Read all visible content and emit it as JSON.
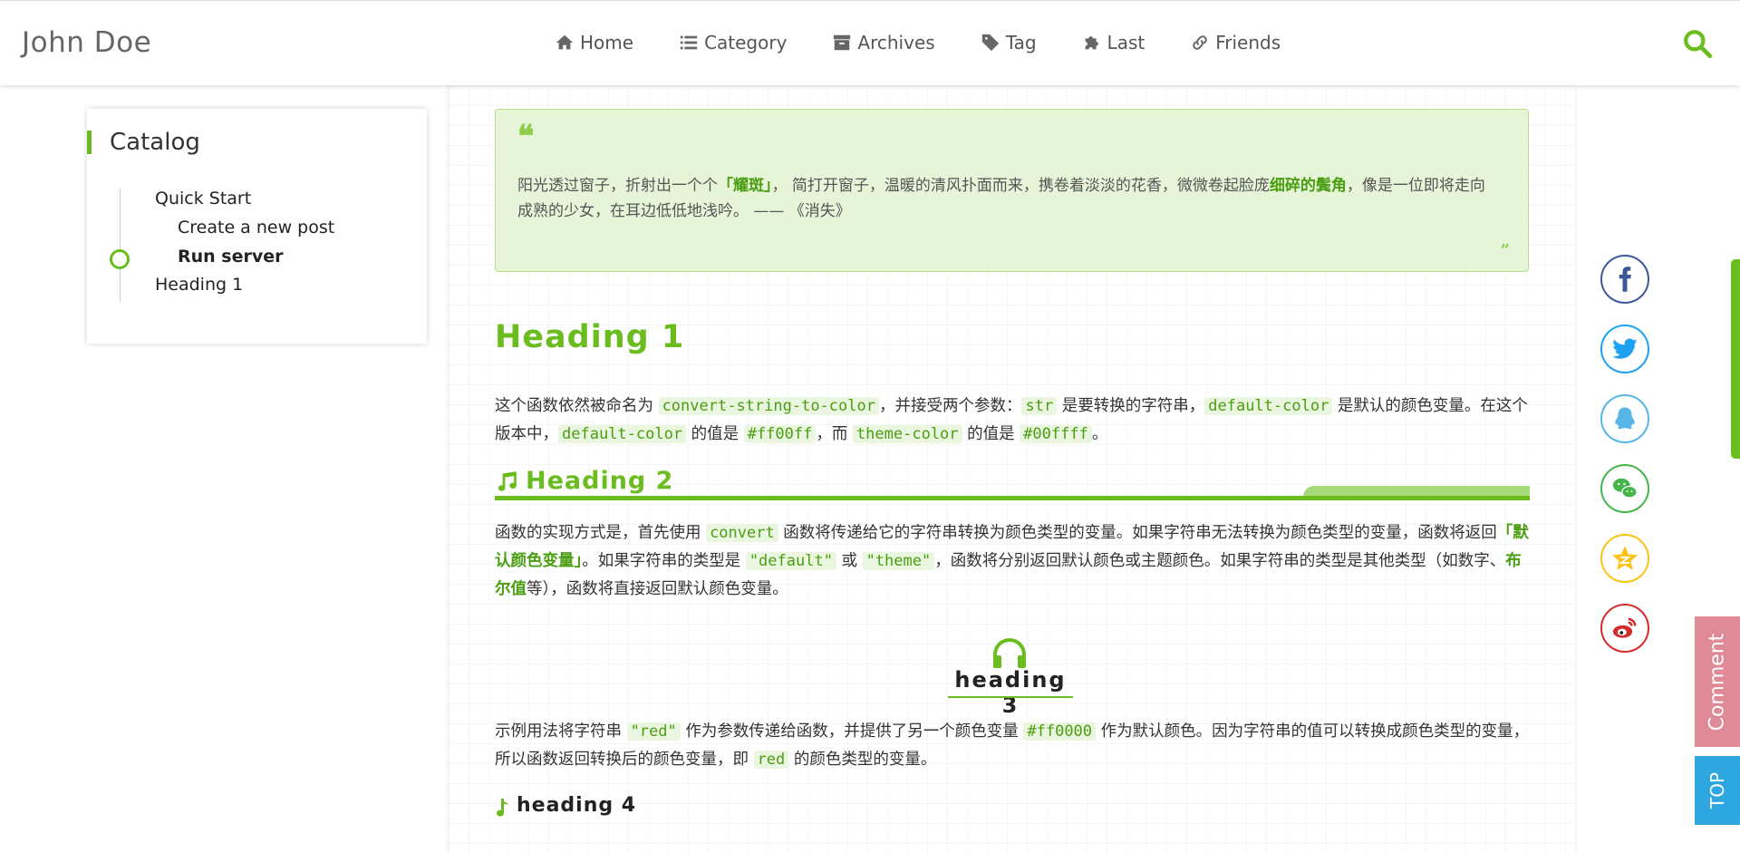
{
  "header": {
    "brand": "John Doe",
    "nav": [
      {
        "label": "Home",
        "icon": "home-icon"
      },
      {
        "label": "Category",
        "icon": "list-icon"
      },
      {
        "label": "Archives",
        "icon": "archive-icon"
      },
      {
        "label": "Tag",
        "icon": "tag-icon"
      },
      {
        "label": "Last",
        "icon": "puzzle-icon"
      },
      {
        "label": "Friends",
        "icon": "link-icon"
      }
    ],
    "search_icon": "search-icon"
  },
  "catalog": {
    "title": "Catalog",
    "items": [
      {
        "label": "Quick Start",
        "level": 1,
        "active": false
      },
      {
        "label": "Create a new post",
        "level": 2,
        "active": false
      },
      {
        "label": "Run server",
        "level": 2,
        "active": true
      },
      {
        "label": "Heading 1",
        "level": 1,
        "active": false
      }
    ]
  },
  "quote": {
    "open_mark": "❝",
    "close_mark": "”",
    "text_1": "阳光透过窗子，折射出一个个",
    "highlight_1": "「耀斑」",
    "text_2": "， 简打开窗子，温暖的清风扑面而来，携卷着淡淡的花香，微微卷起脸庞",
    "highlight_2": "细碎的鬓角",
    "text_3": "，像是一位即将走向成熟的少女，在耳边低低地浅吟。 —— 《消失》"
  },
  "article": {
    "h1": "Heading 1",
    "p1": {
      "t1": "这个函数依然被命名为 ",
      "c1": "convert-string-to-color",
      "t2": "，并接受两个参数：",
      "c2": "str",
      "t3": " 是要转换的字符串，",
      "c3": "default-color",
      "t4": " 是默认的颜色变量。在这个版本中，",
      "c4": "default-color",
      "t5": " 的值是 ",
      "c5": "#ff00ff",
      "t6": "，而 ",
      "c6": "theme-color",
      "t7": " 的值是 ",
      "c7": "#00ffff",
      "t8": "。"
    },
    "h2": "Heading 2",
    "p2": {
      "t1": "函数的实现方式是，首先使用 ",
      "c1": "convert",
      "t2": " 函数将传递给它的字符串转换为颜色类型的变量。如果字符串无法转换为颜色类型的变量，函数将返回",
      "b1": "「默认颜色变量」",
      "t3": "。如果字符串的类型是 ",
      "c2": "\"default\"",
      "t4": " 或 ",
      "c3": "\"theme\"",
      "t5": "，函数将分别返回默认颜色或主题颜色。如果字符串的类型是其他类型（如数字、",
      "b2": "布尔值",
      "t6": "等），函数将直接返回默认颜色变量。"
    },
    "h3": "heading 3",
    "p3": {
      "t1": "示例用法将字符串 ",
      "c1": "\"red\"",
      "t2": " 作为参数传递给函数，并提供了另一个颜色变量 ",
      "c2": "#ff0000",
      "t3": " 作为默认颜色。因为字符串的值可以转换成颜色类型的变量，所以函数返回转换后的颜色变量，即 ",
      "c3": "red",
      "t4": " 的颜色类型的变量。"
    },
    "h4": "heading 4"
  },
  "share": [
    {
      "name": "facebook-icon",
      "color": "#3b5998"
    },
    {
      "name": "twitter-icon",
      "color": "#1da1f2"
    },
    {
      "name": "qq-icon",
      "color": "#56b6e7"
    },
    {
      "name": "wechat-icon",
      "color": "#44b549"
    },
    {
      "name": "qzone-icon",
      "color": "#fbc312"
    },
    {
      "name": "weibo-icon",
      "color": "#d52b2a"
    }
  ],
  "side_tabs": {
    "comment": "Comment",
    "top": "TOP"
  },
  "colors": {
    "accent": "#6bbd1f",
    "quote_bg": "#e6f5d8",
    "comment_tab": "#e08a98",
    "top_tab": "#2ea6e0"
  }
}
